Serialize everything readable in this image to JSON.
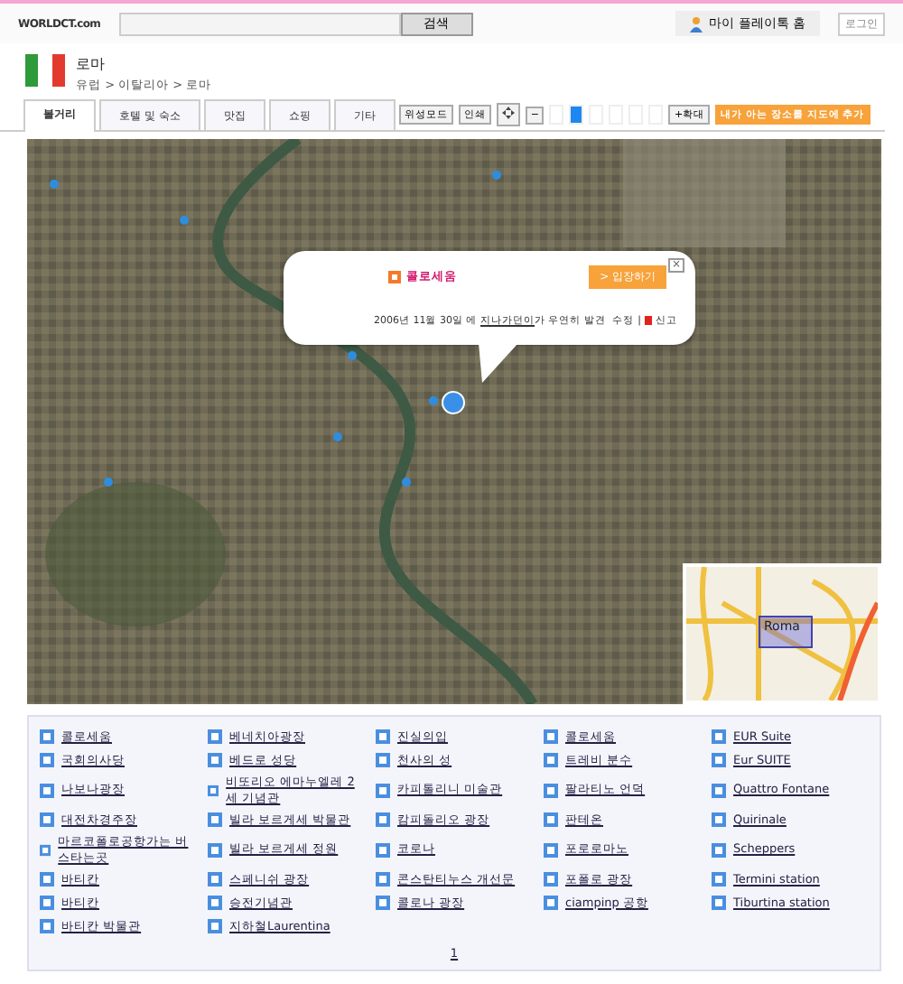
{
  "header": {
    "logo": "WORLDCT.com",
    "search_button": "검색",
    "my_homepage": "마이 플레이톡 홈",
    "login": "로그인"
  },
  "place": {
    "name": "로마",
    "breadcrumb": "유럽 > 이탈리아 > 로마"
  },
  "tabs": [
    {
      "label": "볼거리",
      "selected": true
    },
    {
      "label": "호텔 및 숙소",
      "selected": false
    },
    {
      "label": "맛집",
      "selected": false
    },
    {
      "label": "쇼핑",
      "selected": false
    },
    {
      "label": "기타",
      "selected": false
    }
  ],
  "toolbar": {
    "satellite": "위성모드",
    "print": "인쇄",
    "zoom_out": "−",
    "zoom_segments": [
      {
        "selected": false
      },
      {
        "selected": true
      },
      {
        "selected": false
      },
      {
        "selected": false
      },
      {
        "selected": false
      },
      {
        "selected": false
      }
    ],
    "zoom_in": "+확대",
    "add_place": "내가 아는 장소를 지도에 추가"
  },
  "popup": {
    "title": "콜로세움",
    "enter": "> 입장하기",
    "close": "×",
    "note_before": "2006년 11월 30일 에 ",
    "note_link": "지나가던이",
    "note_after": "가 우연히 발견",
    "edit": "수정",
    "separator": "|",
    "report": "신고"
  },
  "minimap": {
    "label": "Roma"
  },
  "places": [
    [
      "콜로세움",
      "국회의사당",
      "나보나광장",
      "대전차경주장",
      "마르코폴로공항가는 버스타는곳",
      "바티칸",
      "바티칸",
      "바티칸 박물관"
    ],
    [
      "베네치아광장",
      "베드로 성당",
      "비또리오 에마누엘레 2세 기념관",
      "빌라 보르게세 박물관",
      "빌라 보르게세 정원",
      "스페니쉬 광장",
      "승전기념관",
      "지하철Laurentina"
    ],
    [
      "진실의입",
      "천사의 성",
      "카피톨리니 미술관",
      "캄피돌리오 광장",
      "코로나",
      "콘스탄티누스 개선문",
      "콜로나 광장"
    ],
    [
      "콜로세움",
      "트레비 분수",
      "팔라티노 언덕",
      "판테온",
      "포로로마노",
      "포폴로 광장",
      "ciampinp 공항"
    ],
    [
      "EUR Suite",
      "Eur SUITE",
      "Quattro Fontane",
      "Quirinale",
      "Scheppers",
      "Termini station",
      "Tiburtina station"
    ]
  ],
  "pagination": [
    "1"
  ]
}
